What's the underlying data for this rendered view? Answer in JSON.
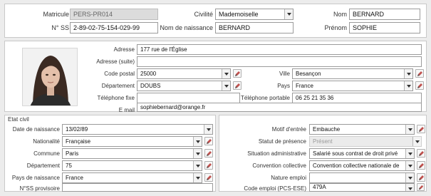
{
  "header": {
    "matricule": {
      "label": "Matricule",
      "value": "PERS-PR014"
    },
    "civilite": {
      "label": "Civilité",
      "value": "Mademoiselle"
    },
    "nom": {
      "label": "Nom",
      "value": "BERNARD"
    },
    "nss": {
      "label": "N° SS",
      "value": "2-89-02-75-154-029-99"
    },
    "nom_naissance": {
      "label": "Nom de naissance",
      "value": "BERNARD"
    },
    "prenom": {
      "label": "Prénom",
      "value": "SOPHIE"
    }
  },
  "contact": {
    "adresse": {
      "label": "Adresse",
      "value": "177 rue de l'Église"
    },
    "adresse_suite": {
      "label": "Adresse (suite)",
      "value": ""
    },
    "code_postal": {
      "label": "Code postal",
      "value": "25000"
    },
    "ville": {
      "label": "Ville",
      "value": "Besançon"
    },
    "departement": {
      "label": "Département",
      "value": "DOUBS"
    },
    "pays": {
      "label": "Pays",
      "value": "France"
    },
    "tel_fixe": {
      "label": "Téléphone fixe",
      "value": ""
    },
    "tel_portable": {
      "label": "Téléphone portable",
      "value": "06 25 21 35 36"
    },
    "email": {
      "label": "E mail",
      "value": "sophiebernard@orange.fr"
    }
  },
  "etat_civil": {
    "title": "Etat civil",
    "date_naissance": {
      "label": "Date de naissance",
      "value": "13/02/89"
    },
    "nationalite": {
      "label": "Nationalité",
      "value": "Française"
    },
    "commune": {
      "label": "Commune",
      "value": "Paris"
    },
    "departement": {
      "label": "Département",
      "value": "75"
    },
    "pays_naissance": {
      "label": "Pays de naissance",
      "value": "France"
    },
    "nss_provisoire": {
      "label": "N°SS provisoire",
      "value": ""
    }
  },
  "emploi": {
    "motif_entree": {
      "label": "Motif d'entrée",
      "value": "Embauche"
    },
    "statut_presence": {
      "label": "Statut de présence",
      "value": "Présent"
    },
    "situation_admin": {
      "label": "Situation administrative",
      "value": "Salarié sous contrat de droit privé"
    },
    "convention": {
      "label": "Convention collective",
      "value": "Convention collective nationale de"
    },
    "nature_emploi": {
      "label": "Nature emploi",
      "value": ""
    },
    "code_emploi": {
      "label": "Code emploi (PCS-ESE)",
      "value": "479A"
    }
  },
  "icons": {
    "dropdown": "chevron-down-icon",
    "edit": "pencil-edit-icon",
    "photo": "employee-photo"
  },
  "colors": {
    "background": "#ececec",
    "panel": "#ffffff",
    "readonly_field": "#dcdcdc",
    "edit_pencil": "#c0504d"
  }
}
